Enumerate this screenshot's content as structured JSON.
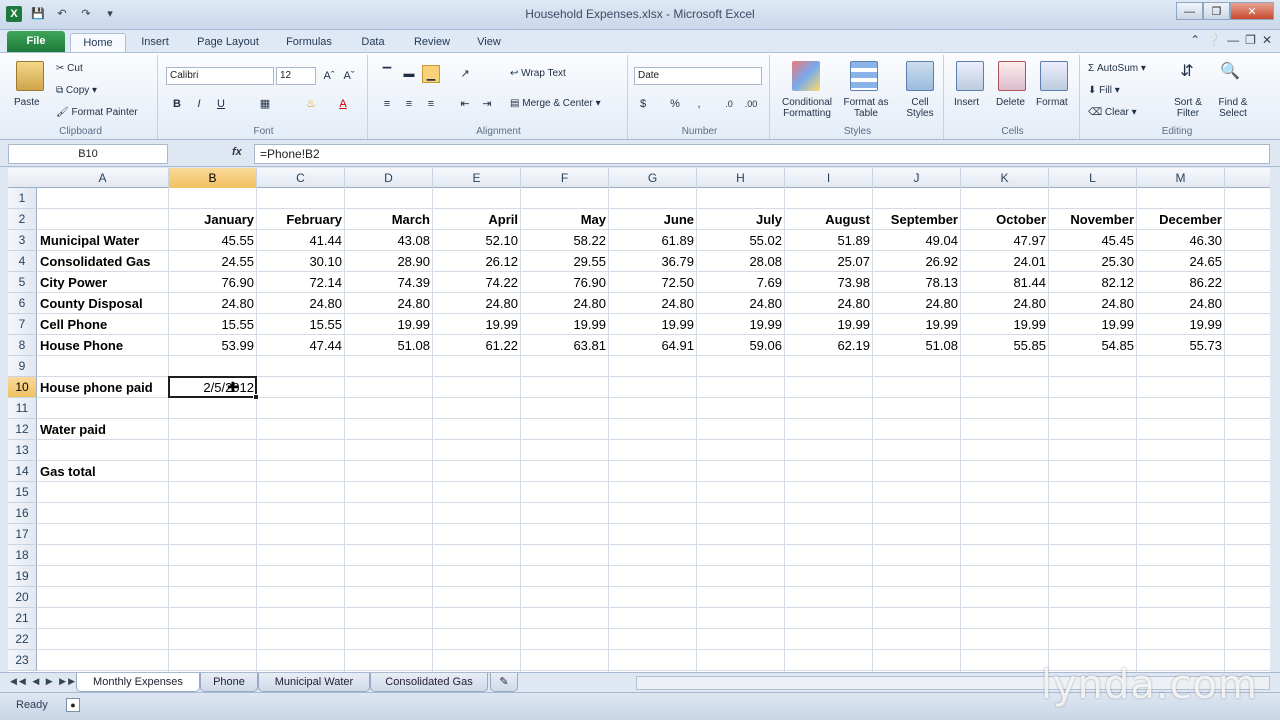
{
  "window": {
    "title": "Household Expenses.xlsx - Microsoft Excel",
    "qat": [
      "save-icon",
      "undo-icon",
      "redo-icon"
    ]
  },
  "ribbon": {
    "file_tab": "File",
    "tabs": [
      "Home",
      "Insert",
      "Page Layout",
      "Formulas",
      "Data",
      "Review",
      "View"
    ],
    "clipboard": {
      "label": "Clipboard",
      "paste": "Paste",
      "cut": "Cut",
      "copy": "Copy",
      "format_painter": "Format Painter"
    },
    "font": {
      "label": "Font",
      "name": "Calibri",
      "size": "12"
    },
    "alignment": {
      "label": "Alignment",
      "wrap_text": "Wrap Text",
      "merge_center": "Merge & Center"
    },
    "number": {
      "label": "Number",
      "format": "Date"
    },
    "styles": {
      "label": "Styles",
      "conditional": "Conditional Formatting",
      "format_table": "Format as Table",
      "cell_styles": "Cell Styles"
    },
    "cells": {
      "label": "Cells",
      "insert": "Insert",
      "delete": "Delete",
      "format": "Format"
    },
    "editing": {
      "label": "Editing",
      "autosum": "AutoSum",
      "fill": "Fill",
      "clear": "Clear",
      "sort_filter": "Sort & Filter",
      "find_select": "Find & Select"
    }
  },
  "formula_bar": {
    "name_box": "B10",
    "fx": "fx",
    "formula": "=Phone!B2"
  },
  "columns": [
    "A",
    "B",
    "C",
    "D",
    "E",
    "F",
    "G",
    "H",
    "I",
    "J",
    "K",
    "L",
    "M"
  ],
  "rows": [
    "1",
    "2",
    "3",
    "4",
    "5",
    "6",
    "7",
    "8",
    "9",
    "10",
    "11",
    "12",
    "13",
    "14",
    "15",
    "16",
    "17",
    "18",
    "19",
    "20",
    "21",
    "22",
    "23"
  ],
  "sheet": {
    "months": [
      "January",
      "February",
      "March",
      "April",
      "May",
      "June",
      "July",
      "August",
      "September",
      "October",
      "November",
      "December"
    ],
    "expenses": [
      {
        "label": "Municipal Water",
        "values": [
          "45.55",
          "41.44",
          "43.08",
          "52.10",
          "58.22",
          "61.89",
          "55.02",
          "51.89",
          "49.04",
          "47.97",
          "45.45",
          "46.30"
        ]
      },
      {
        "label": "Consolidated Gas",
        "values": [
          "24.55",
          "30.10",
          "28.90",
          "26.12",
          "29.55",
          "36.79",
          "28.08",
          "25.07",
          "26.92",
          "24.01",
          "25.30",
          "24.65"
        ]
      },
      {
        "label": "City Power",
        "values": [
          "76.90",
          "72.14",
          "74.39",
          "74.22",
          "76.90",
          "72.50",
          "7.69",
          "73.98",
          "78.13",
          "81.44",
          "82.12",
          "86.22"
        ]
      },
      {
        "label": "County Disposal",
        "values": [
          "24.80",
          "24.80",
          "24.80",
          "24.80",
          "24.80",
          "24.80",
          "24.80",
          "24.80",
          "24.80",
          "24.80",
          "24.80",
          "24.80"
        ]
      },
      {
        "label": "Cell Phone",
        "values": [
          "15.55",
          "15.55",
          "19.99",
          "19.99",
          "19.99",
          "19.99",
          "19.99",
          "19.99",
          "19.99",
          "19.99",
          "19.99",
          "19.99"
        ]
      },
      {
        "label": "House Phone",
        "values": [
          "53.99",
          "47.44",
          "51.08",
          "61.22",
          "63.81",
          "64.91",
          "59.06",
          "62.19",
          "51.08",
          "55.85",
          "54.85",
          "55.73"
        ]
      }
    ],
    "house_phone_paid_label": "House phone paid",
    "house_phone_paid_value": "2/5/2012",
    "water_paid_label": "Water paid",
    "gas_total_label": "Gas total"
  },
  "sheet_tabs": [
    "Monthly Expenses",
    "Phone",
    "Municipal Water",
    "Consolidated Gas"
  ],
  "status": {
    "text": "Ready"
  },
  "watermark": "lynda.com"
}
